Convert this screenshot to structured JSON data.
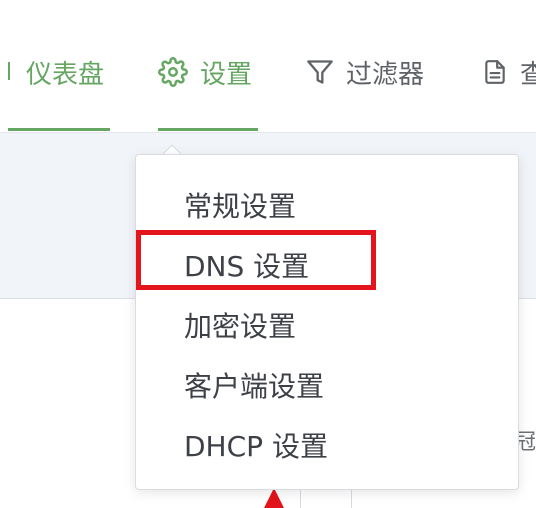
{
  "nav": {
    "items": [
      {
        "label": "仪表盘",
        "icon": "dashboard-icon",
        "active": true
      },
      {
        "label": "设置",
        "icon": "gear-icon",
        "active": true
      },
      {
        "label": "过滤器",
        "icon": "filter-icon",
        "active": false
      },
      {
        "label": "查",
        "icon": "document-icon",
        "active": false
      }
    ]
  },
  "dropdown": {
    "items": [
      {
        "label": "常规设置"
      },
      {
        "label": "DNS 设置",
        "highlighted": true
      },
      {
        "label": "加密设置"
      },
      {
        "label": "客户端设置"
      },
      {
        "label": "DHCP 设置"
      }
    ]
  },
  "background": {
    "cut_text": "冠"
  },
  "colors": {
    "accent": "#66a663",
    "text": "#3d4147",
    "muted": "#5f6369",
    "band": "#f1f4f8",
    "highlight": "#e3141b"
  }
}
